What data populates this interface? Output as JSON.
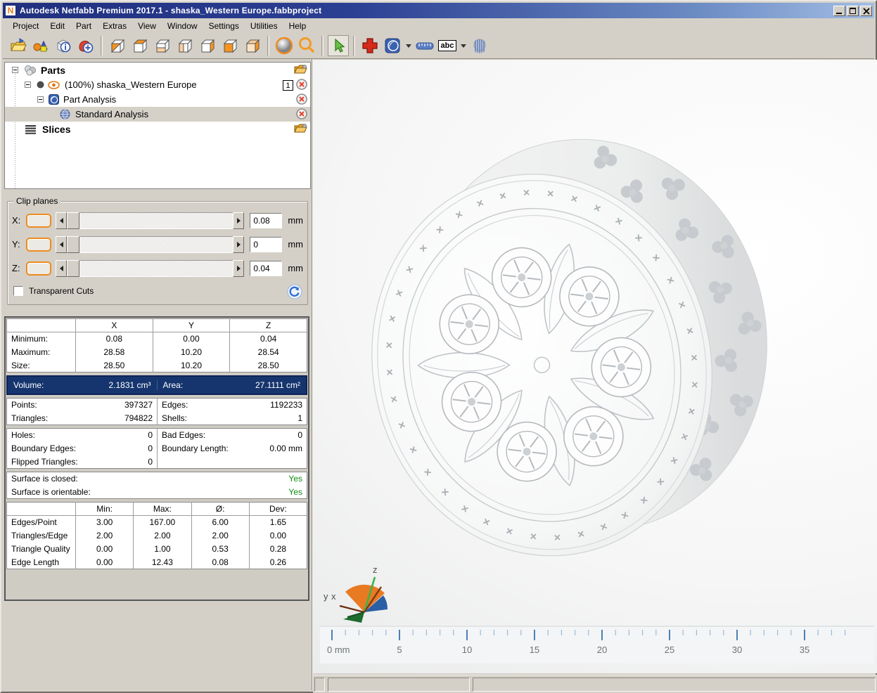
{
  "window": {
    "title": "Autodesk Netfabb Premium 2017.1 - shaska_Western Europe.fabbproject",
    "app_icon_letter": "N"
  },
  "menu": {
    "items": [
      "Project",
      "Edit",
      "Part",
      "Extras",
      "View",
      "Window",
      "Settings",
      "Utilities",
      "Help"
    ]
  },
  "toolbar": {
    "abc_label": "abc"
  },
  "tree": {
    "parts": {
      "label": "Parts"
    },
    "part": {
      "label": "(100%) shaska_Western Europe",
      "badge": "1"
    },
    "part_analysis": {
      "label": "Part Analysis"
    },
    "standard_analysis": {
      "label": "Standard Analysis"
    },
    "slices": {
      "label": "Slices"
    }
  },
  "clip_planes": {
    "title": "Clip planes",
    "x": {
      "label": "X:",
      "value": "0.08",
      "unit": "mm"
    },
    "y": {
      "label": "Y:",
      "value": "0",
      "unit": "mm"
    },
    "z": {
      "label": "Z:",
      "value": "0.04",
      "unit": "mm"
    },
    "transparent_cuts_label": "Transparent Cuts"
  },
  "stats": {
    "dims": {
      "col_x": "X",
      "col_y": "Y",
      "col_z": "Z",
      "rows": [
        {
          "label": "Minimum:",
          "x": "0.08",
          "y": "0.00",
          "z": "0.04"
        },
        {
          "label": "Maximum:",
          "x": "28.58",
          "y": "10.20",
          "z": "28.54"
        },
        {
          "label": "Size:",
          "x": "28.50",
          "y": "10.20",
          "z": "28.50"
        }
      ]
    },
    "volume": {
      "label": "Volume:",
      "value": "2.1831 cm³"
    },
    "area": {
      "label": "Area:",
      "value": "27.1111 cm²"
    },
    "mesh": {
      "points_label": "Points:",
      "points": "397327",
      "edges_label": "Edges:",
      "edges": "1192233",
      "triangles_label": "Triangles:",
      "triangles": "794822",
      "shells_label": "Shells:",
      "shells": "1"
    },
    "defects": {
      "holes_label": "Holes:",
      "holes": "0",
      "bad_edges_label": "Bad Edges:",
      "bad_edges": "0",
      "boundary_edges_label": "Boundary Edges:",
      "boundary_edges": "0",
      "boundary_length_label": "Boundary Length:",
      "boundary_length": "0.00 mm",
      "flipped_label": "Flipped Triangles:",
      "flipped": "0"
    },
    "surface": {
      "closed_label": "Surface is closed:",
      "closed": "Yes",
      "orientable_label": "Surface is orientable:",
      "orientable": "Yes"
    },
    "quality": {
      "col_min": "Min:",
      "col_max": "Max:",
      "col_avg": "Ø:",
      "col_dev": "Dev:",
      "rows": [
        {
          "label": "Edges/Point",
          "min": "3.00",
          "max": "167.00",
          "avg": "6.00",
          "dev": "1.65"
        },
        {
          "label": "Triangles/Edge",
          "min": "2.00",
          "max": "2.00",
          "avg": "2.00",
          "dev": "0.00"
        },
        {
          "label": "Triangle Quality",
          "min": "0.00",
          "max": "1.00",
          "avg": "0.53",
          "dev": "0.28"
        },
        {
          "label": "Edge Length",
          "min": "0.00",
          "max": "12.43",
          "avg": "0.08",
          "dev": "0.26"
        }
      ]
    }
  },
  "viewport": {
    "axis": {
      "z": "z",
      "y": "y",
      "x": "x"
    },
    "ruler": {
      "labels": [
        "0 mm",
        "5",
        "10",
        "15",
        "20",
        "25",
        "30",
        "35"
      ]
    }
  },
  "colors": {
    "accent_orange": "#ef8b1e",
    "navy_row": "#16356e",
    "yes_green": "#128a12",
    "titlebar_left": "#20307f",
    "titlebar_right": "#a3bde4",
    "ruler_tick_major": "#4e80b6"
  }
}
